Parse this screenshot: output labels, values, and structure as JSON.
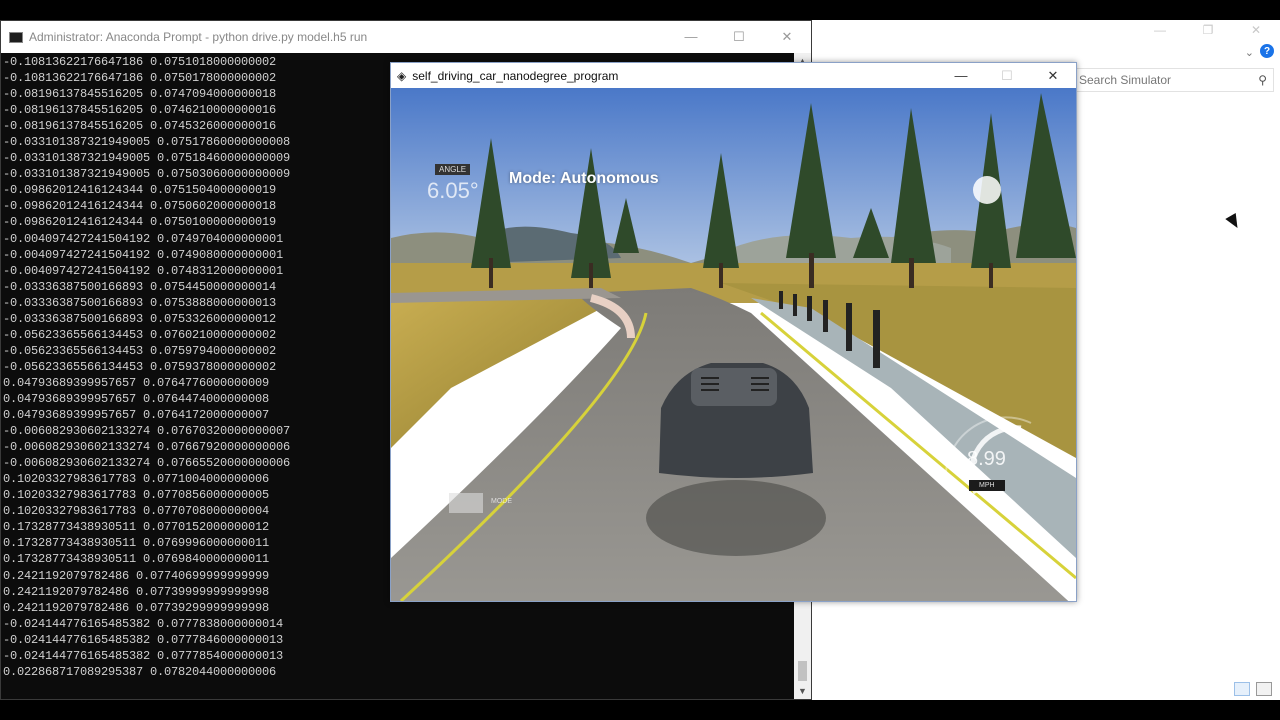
{
  "console": {
    "title": "Administrator: Anaconda Prompt - python  drive.py model.h5 run",
    "minimize": "—",
    "maximize": "☐",
    "close": "✕",
    "lines": [
      "-0.1081362217664718​6 0.0751018000000002",
      "-0.10813622176647186 0.0750178000000002",
      "-0.0819613784551620​5 0.0747094000000018",
      "-0.08196137845516205 0.0746210000000016",
      "-0.08196137845516205 0.0745326000000016",
      "-0.033101387321949005 0.07517860000000008",
      "-0.033101387321949005 0.07518460000000009",
      "-0.033101387321949005 0.07503060000000009",
      "-0.0986201241612434​4 0.0751504000000019",
      "-0.09862012416124344 0.0750602000000018",
      "-0.09862012416124344 0.0750100000000019",
      "-0.004097427241504192 0.0749704000000001",
      "-0.004097427241504192 0.0749080000000001",
      "-0.004097427241504192 0.0748312000000001",
      "-0.03336387500166893 0.0754450000000014",
      "-0.03336387500166893 0.0753888000000013",
      "-0.03336387500166893 0.0753326000000012",
      "-0.05623365566134453 0.0760210000000002",
      "-0.05623365566134453 0.0759794000000002",
      "-0.05623365566134453 0.0759378000000002",
      "0.04793689399957657 0.0764776000000009",
      "0.04793689399957657 0.0764474000000008",
      "0.04793689399957657 0.0764172000000007",
      "-0.006082930602133274 0.07670320000000007",
      "-0.006082930602133274 0.07667920000000006",
      "-0.006082930602133274 0.07665520000000006",
      "0.10203327983617783 0.0771004000000006",
      "0.10203327983617783 0.0770856000000005",
      "0.10203327983617783 0.0770708000000004",
      "0.17328773438930511 0.0770152000000012",
      "0.17328773438930511 0.0769996000000011",
      "0.17328773438930511 0.0769840000000011",
      "0.2421192079782486 0.07740699999999999",
      "0.2421192079782486 0.07739999999999998",
      "0.2421192079782486 0.07739299999999998",
      "-0.024144776165485382 0.0777838000000014",
      "-0.024144776165485382 0.0777846000000013",
      "-0.024144776165485382 0.0777854000000013",
      "0.022868717089295387 0.0782044000000006"
    ]
  },
  "simulator": {
    "title": "self_driving_car_nanodegree_program",
    "minimize": "—",
    "maximize": "☐",
    "close": "✕",
    "hud": {
      "angle_label": "ANGLE",
      "angle_value": "6.05°",
      "mode": "Mode: Autonomous",
      "speed": "8.99",
      "speed_unit": "MPH",
      "mode_button_label": "MODE"
    }
  },
  "explorer": {
    "search_placeholder": "Search Simulator",
    "help": "?",
    "chevron": "⌄"
  },
  "colors": {
    "console_bg": "#0c0c0c",
    "console_text": "#d0d0d0",
    "sky_top": "#4a78c8",
    "road": "#8c8a86",
    "grass": "#b7a24a"
  }
}
